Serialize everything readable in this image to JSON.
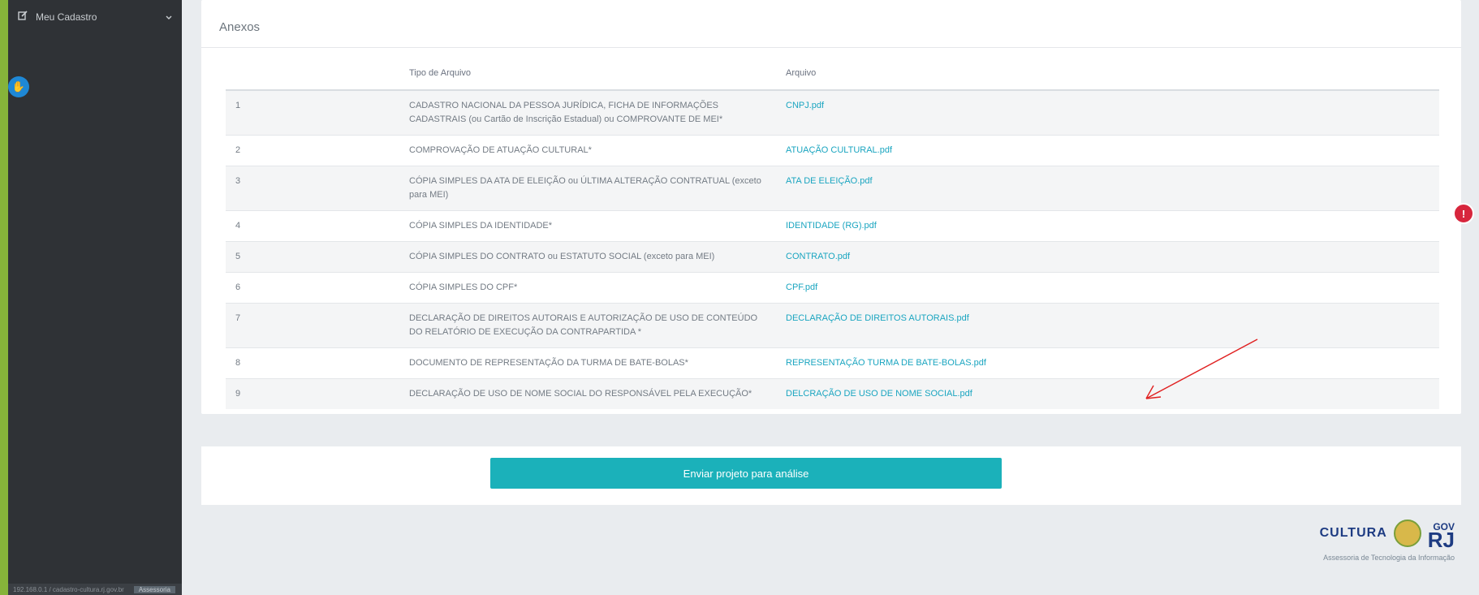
{
  "sidebar": {
    "menu_item_label": "Meu Cadastro",
    "status_text": "192.168.0.1 / cadastro-cultura.rj.gov.br",
    "status_highlight": "Assessoria"
  },
  "anexos": {
    "title": "Anexos",
    "columns": [
      "",
      "Tipo de Arquivo",
      "Arquivo"
    ],
    "rows": [
      {
        "num": "1",
        "type": "CADASTRO NACIONAL DA PESSOA JURÍDICA, FICHA DE INFORMAÇÕES CADASTRAIS (ou Cartão de Inscrição Estadual) ou COMPROVANTE DE MEI*",
        "file": "CNPJ.pdf"
      },
      {
        "num": "2",
        "type": "COMPROVAÇÃO DE ATUAÇÃO CULTURAL*",
        "file": "ATUAÇÃO CULTURAL.pdf"
      },
      {
        "num": "3",
        "type": "CÓPIA SIMPLES DA ATA DE ELEIÇÃO ou ÚLTIMA ALTERAÇÃO CONTRATUAL (exceto para MEI)",
        "file": "ATA DE ELEIÇÃO.pdf"
      },
      {
        "num": "4",
        "type": "CÓPIA SIMPLES DA IDENTIDADE*",
        "file": "IDENTIDADE (RG).pdf"
      },
      {
        "num": "5",
        "type": "CÓPIA SIMPLES DO CONTRATO ou ESTATUTO SOCIAL (exceto para MEI)",
        "file": "CONTRATO.pdf"
      },
      {
        "num": "6",
        "type": "CÓPIA SIMPLES DO CPF*",
        "file": "CPF.pdf"
      },
      {
        "num": "7",
        "type": "DECLARAÇÃO DE DIREITOS AUTORAIS E AUTORIZAÇÃO DE USO DE CONTEÚDO DO RELATÓRIO DE EXECUÇÃO DA CONTRAPARTIDA *",
        "file": "DECLARAÇÃO DE DIREITOS AUTORAIS.pdf"
      },
      {
        "num": "8",
        "type": "DOCUMENTO DE REPRESENTAÇÃO DA TURMA DE BATE-BOLAS*",
        "file": "REPRESENTAÇÃO TURMA DE BATE-BOLAS.pdf"
      },
      {
        "num": "9",
        "type": "DECLARAÇÃO DE USO DE NOME SOCIAL DO RESPONSÁVEL PELA EXECUÇÃO*",
        "file": "DELCRAÇÃO DE USO DE NOME SOCIAL.pdf"
      }
    ]
  },
  "submit": {
    "label": "Enviar projeto para análise"
  },
  "logo": {
    "cultura": "CULTURA",
    "gov": "GOV",
    "rj": "RJ",
    "subtitle": "Assessoria de Tecnologia da Informação"
  },
  "colors": {
    "sidebar_bg": "#2f3236",
    "accent": "#1bb1ba",
    "link": "#1aa5c0",
    "arrow": "#e02020"
  }
}
